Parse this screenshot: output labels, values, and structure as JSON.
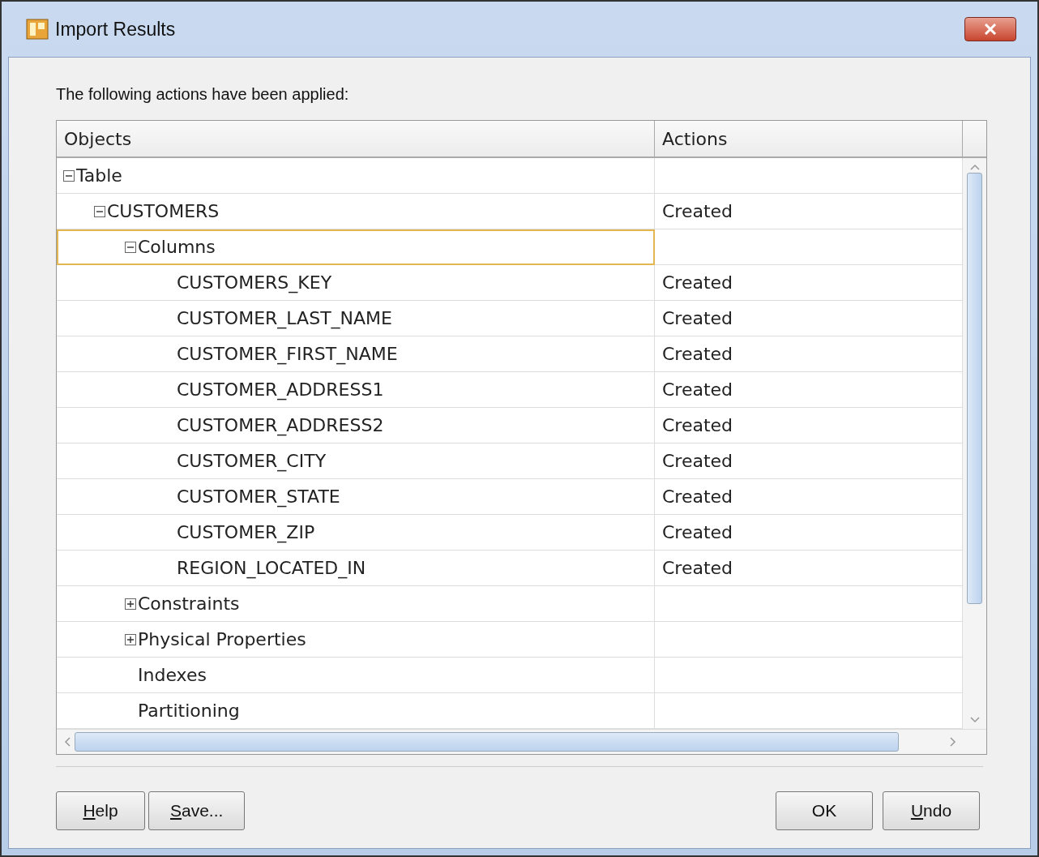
{
  "window": {
    "title": "Import Results"
  },
  "intro": "The following actions have been applied:",
  "table": {
    "columns": [
      "Objects",
      "Actions"
    ],
    "rows": [
      {
        "name": "Table",
        "expanded": true,
        "children": [
          {
            "name": "CUSTOMERS",
            "action": "Created",
            "expanded": true,
            "children": [
              {
                "name": "Columns",
                "expanded": true,
                "selected": true,
                "children": [
                  {
                    "name": "CUSTOMERS_KEY",
                    "action": "Created",
                    "selected": false
                  },
                  {
                    "name": "CUSTOMER_LAST_NAME",
                    "action": "Created",
                    "selected": false
                  },
                  {
                    "name": "CUSTOMER_FIRST_NAME",
                    "action": "Created",
                    "selected": false
                  },
                  {
                    "name": "CUSTOMER_ADDRESS1",
                    "action": "Created",
                    "selected": false
                  },
                  {
                    "name": "CUSTOMER_ADDRESS2",
                    "action": "Created",
                    "selected": false
                  },
                  {
                    "name": "CUSTOMER_CITY",
                    "action": "Created",
                    "selected": false
                  },
                  {
                    "name": "CUSTOMER_STATE",
                    "action": "Created",
                    "selected": false
                  },
                  {
                    "name": "CUSTOMER_ZIP",
                    "action": "Created",
                    "selected": false
                  },
                  {
                    "name": "REGION_LOCATED_IN",
                    "action": "Created",
                    "selected": false
                  }
                ]
              },
              {
                "name": "Constraints",
                "expanded": false,
                "selected": false
              },
              {
                "name": "Physical Properties",
                "expanded": false,
                "selected": false
              },
              {
                "name": "Indexes",
                "selected": false
              },
              {
                "name": "Partitioning",
                "selected": false
              }
            ],
            "selected": false
          }
        ],
        "selected": false
      }
    ]
  },
  "buttons_left": [
    {
      "label": "Help",
      "mnemonic": true
    },
    {
      "label": "Save...",
      "mnemonic": true
    }
  ],
  "buttons_right": [
    {
      "label": "OK",
      "mnemonic": false
    },
    {
      "label": "Undo",
      "mnemonic": true
    }
  ]
}
